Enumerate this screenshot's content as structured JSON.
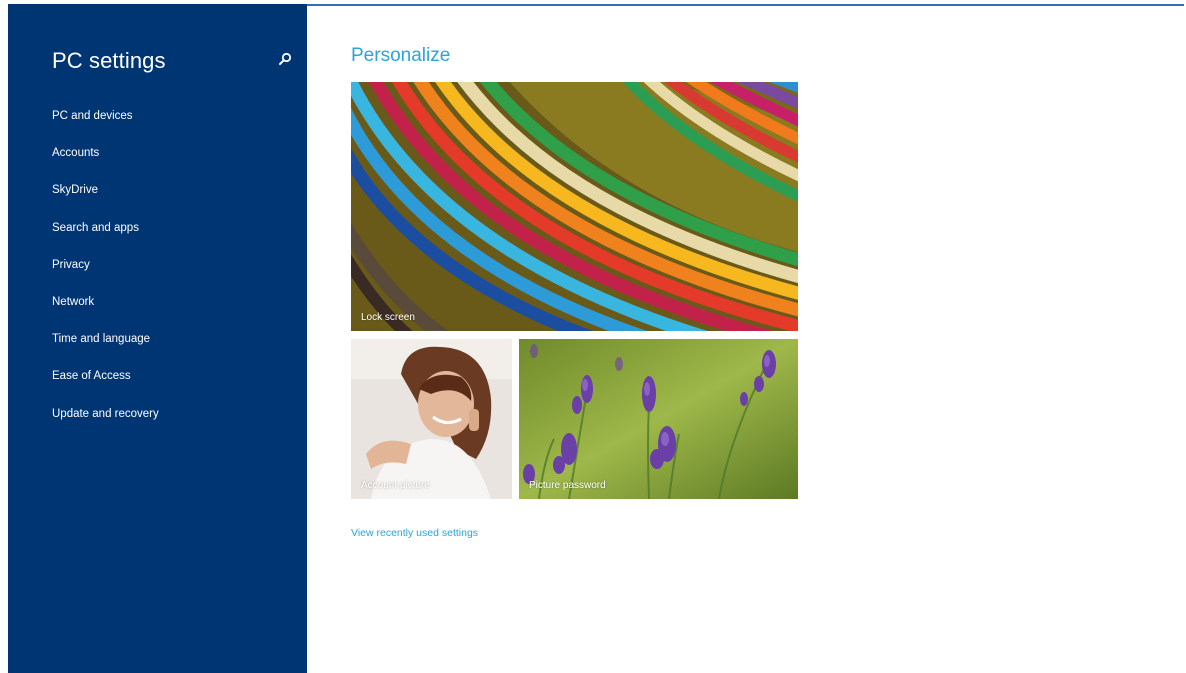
{
  "sidebar": {
    "title": "PC settings",
    "search_icon": "search-icon",
    "background_color": "#003574",
    "items": [
      {
        "label": "PC and devices"
      },
      {
        "label": "Accounts"
      },
      {
        "label": "SkyDrive"
      },
      {
        "label": "Search and apps"
      },
      {
        "label": "Privacy"
      },
      {
        "label": "Network"
      },
      {
        "label": "Time and language"
      },
      {
        "label": "Ease of Access"
      },
      {
        "label": "Update and recovery"
      }
    ]
  },
  "main": {
    "title": "Personalize",
    "accent_color": "#2aa4db",
    "tiles": {
      "lock_screen": {
        "label": "Lock screen"
      },
      "account_picture": {
        "label": "Account picture"
      },
      "picture_password": {
        "label": "Picture password"
      }
    },
    "recent_link": "View recently used settings"
  }
}
